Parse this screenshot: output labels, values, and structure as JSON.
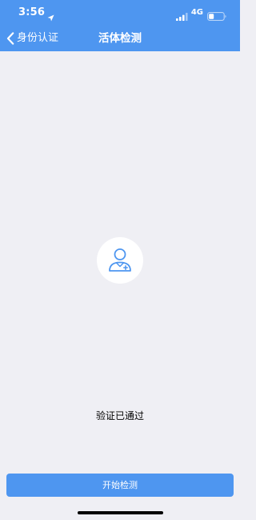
{
  "status_bar": {
    "time": "3:56",
    "network": "4G",
    "icons": [
      "location-arrow-icon",
      "signal-icon",
      "battery-icon"
    ]
  },
  "nav": {
    "back_label": "身份认证",
    "title": "活体检测"
  },
  "main": {
    "avatar_icon": "person-icon",
    "status_text": "验证已通过"
  },
  "footer": {
    "button_label": "开始检测"
  },
  "colors": {
    "accent": "#4E96F0",
    "background": "#EFEFF4",
    "avatar_background": "#FFFFFF",
    "button_text": "#FFFFFF"
  }
}
